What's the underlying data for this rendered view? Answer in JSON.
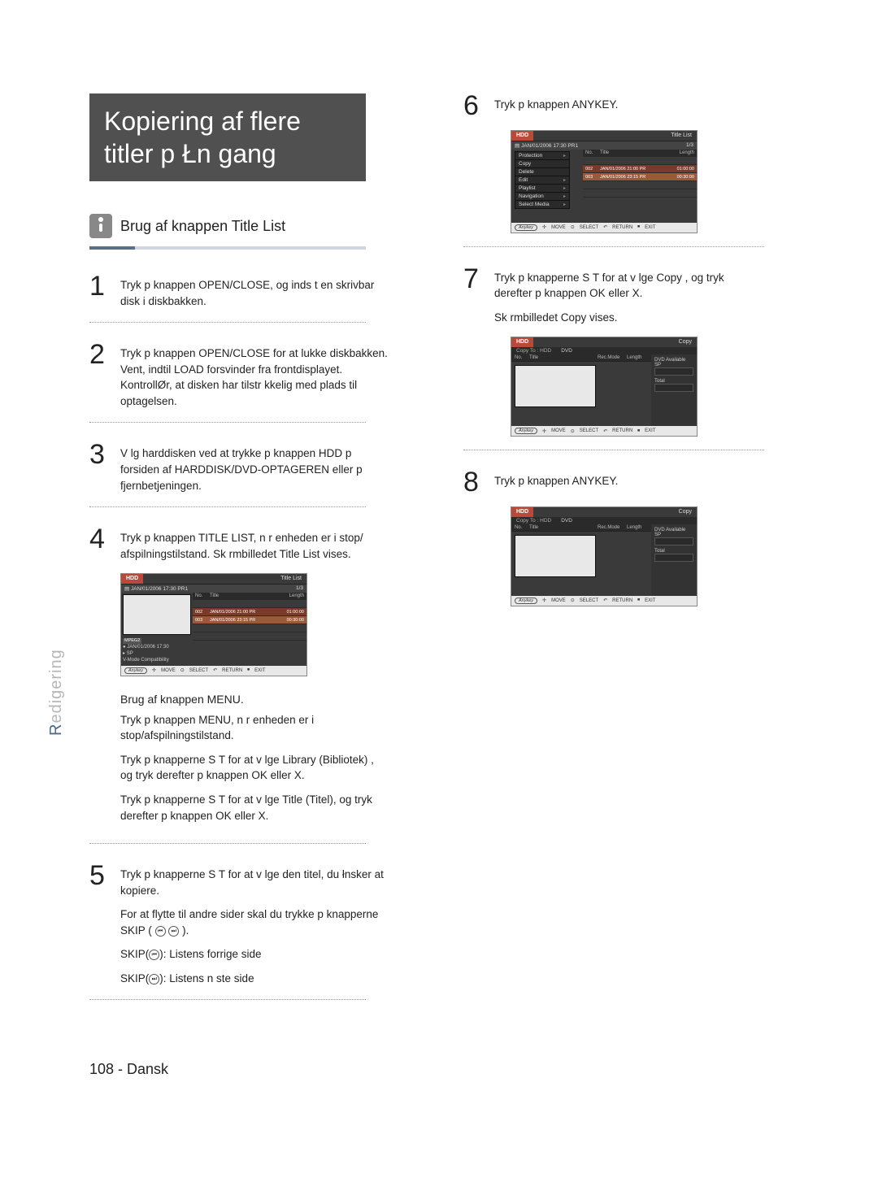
{
  "title_line1": "Kopiering af flere",
  "title_line2": "titler p Łn gang",
  "subhead": "Brug af knappen Title List",
  "side_label": {
    "accent": "R",
    "rest": "edigering"
  },
  "footer": "108 - Dansk",
  "steps_left": {
    "s1": "Tryk p knappen OPEN/CLOSE, og inds t en skrivbar disk i diskbakken.",
    "s2": "Tryk p knappen OPEN/CLOSE for at lukke diskbakken. Vent, indtil LOAD forsvinder fra frontdisplayet. KontrollØr, at disken har tilstr kkelig med plads til optagelsen.",
    "s3": "V lg harddisken ved at trykke p knappen HDD p forsiden af HARDDISK/DVD-OPTAGEREN eller p fjernbetjeningen.",
    "s4": "Tryk p knappen TITLE LIST, n r enheden er i stop/ afspilningstilstand. Sk rmbilledet Title List vises.",
    "s5_a": "Tryk p knapperne S T for at v lge den titel, du łnsker at kopiere.",
    "s5_b": "For at flytte til andre sider skal du trykke p knapperne SKIP (",
    "s5_b_end": ").",
    "s5_c": "SKIP(",
    "s5_c_end": "): Listens forrige side",
    "s5_d": "SKIP(",
    "s5_d_end": "): Listens n ste side"
  },
  "menu_block": {
    "heading": "Brug af knappen MENU.",
    "p1": "Tryk p knappen MENU, n r enheden er i stop/afspilningstilstand.",
    "p2": "Tryk p knapperne S T for at v lge Library (Bibliotek) , og tryk derefter p knappen OK eller X.",
    "p3": "Tryk p knapperne S T for at v lge Title (Titel), og tryk derefter p knappen OK eller X."
  },
  "steps_right": {
    "s6": "Tryk p knappen ANYKEY.",
    "s7_a": "Tryk p knapperne S T for at v lge Copy , og tryk derefter p knappen OK eller X.",
    "s7_b": "Sk rmbilledet Copy vises.",
    "s8": "Tryk p knappen ANYKEY."
  },
  "title_list_screen": {
    "tag": "HDD",
    "right": "Title List",
    "sub_left": "JAN/01/2006 17:30 PR1",
    "sub_right": "1/3",
    "cols": {
      "no": "No.",
      "title": "Title",
      "length": "Length"
    },
    "rows": [
      {
        "no": "002",
        "title": "JAN/01/2006 21:00 PR",
        "length": "01:00:00"
      },
      {
        "no": "003",
        "title": "JAN/01/2006 23:15 PR",
        "length": "00:30:00"
      }
    ],
    "meta": {
      "badge": "MPEG2",
      "line1": "JAN/01/2006 17:30",
      "line2": "SP",
      "line3": "V-Mode Compatibility"
    },
    "foot": {
      "anykey": "Anykey",
      "move": "MOVE",
      "select": "SELECT",
      "ret": "RETURN",
      "exit": "EXIT"
    }
  },
  "context_menu": {
    "items": [
      {
        "label": "Protection",
        "chev": true
      },
      {
        "label": "Copy",
        "chev": false
      },
      {
        "label": "Delete",
        "chev": false
      },
      {
        "label": "Edit",
        "chev": true
      },
      {
        "label": "Playlist",
        "chev": true
      },
      {
        "label": "Navigation",
        "chev": true
      },
      {
        "label": "Select Media",
        "chev": true
      }
    ]
  },
  "copy_screen": {
    "tag": "HDD",
    "right": "Copy",
    "tabs_label": "Copy To : HDD",
    "tab2": "DVD",
    "cols": {
      "no": "No.",
      "title": "Title",
      "rec": "Rec.Mode",
      "length": "Length"
    },
    "right_panel": {
      "avail": "DVD Available",
      "sp": "SP",
      "total": "Total"
    },
    "foot": {
      "anykey": "Anykey",
      "move": "MOVE",
      "select": "SELECT",
      "ret": "RETURN",
      "exit": "EXIT"
    }
  },
  "icons": {
    "skip_prev": "⏮",
    "skip_next": "⏭",
    "nav": "✢",
    "sel": "⊙",
    "ret": "↶",
    "exit": "⏹",
    "rec": "●",
    "cal": "▤"
  }
}
